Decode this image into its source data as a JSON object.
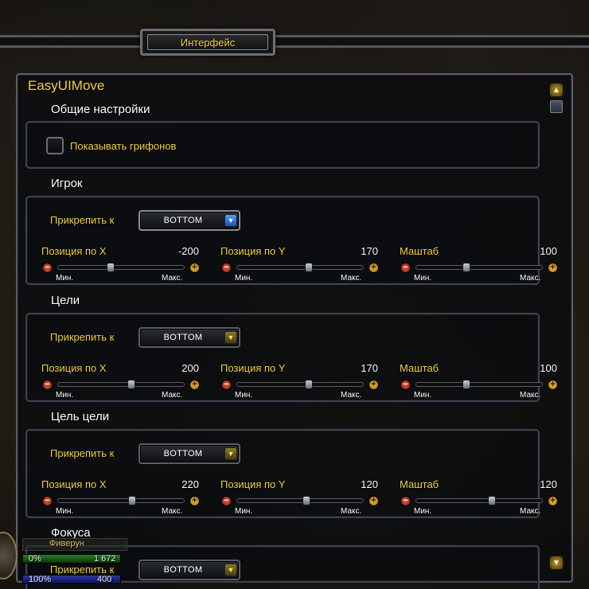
{
  "window_title": "Интерфейс",
  "addon_title": "EasyUIMove",
  "general": {
    "heading": "Общие настройки",
    "checkbox_label": "Показывать грифонов",
    "checkbox_checked": false
  },
  "sections": [
    {
      "heading": "Игрок",
      "anchor_label": "Прикрепить к",
      "anchor_value": "BOTTOM",
      "anchor_active": true,
      "sliders": [
        {
          "label": "Позиция по X",
          "value": "-200",
          "min_label": "Мин.",
          "max_label": "Макс.",
          "fraction": 0.42
        },
        {
          "label": "Позиция по Y",
          "value": "170",
          "min_label": "Мин.",
          "max_label": "Макс.",
          "fraction": 0.57
        },
        {
          "label": "Маштаб",
          "value": "100",
          "min_label": "Мин.",
          "max_label": "Макс.",
          "fraction": 0.4
        }
      ]
    },
    {
      "heading": "Цели",
      "anchor_label": "Прикрепить к",
      "anchor_value": "BOTTOM",
      "anchor_active": false,
      "sliders": [
        {
          "label": "Позиция по X",
          "value": "200",
          "min_label": "Мин.",
          "max_label": "Макс.",
          "fraction": 0.58
        },
        {
          "label": "Позиция по Y",
          "value": "170",
          "min_label": "Мин.",
          "max_label": "Макс.",
          "fraction": 0.57
        },
        {
          "label": "Маштаб",
          "value": "100",
          "min_label": "Мин.",
          "max_label": "Макс.",
          "fraction": 0.4
        }
      ]
    },
    {
      "heading": "Цель цели",
      "anchor_label": "Прикрепить к",
      "anchor_value": "BOTTOM",
      "anchor_active": false,
      "sliders": [
        {
          "label": "Позиция по X",
          "value": "220",
          "min_label": "Мин.",
          "max_label": "Макс.",
          "fraction": 0.59
        },
        {
          "label": "Позиция по Y",
          "value": "120",
          "min_label": "Мин.",
          "max_label": "Макс.",
          "fraction": 0.55
        },
        {
          "label": "Маштаб",
          "value": "120",
          "min_label": "Мин.",
          "max_label": "Макс.",
          "fraction": 0.6
        }
      ]
    },
    {
      "heading": "Фокуса",
      "anchor_label": "Прикрепить к",
      "anchor_value": "BOTTOM",
      "anchor_active": false,
      "sliders": []
    }
  ],
  "unit_frame": {
    "name": "Фиверун",
    "health_percent": "0%",
    "health_value": "1 672",
    "power_percent": "100%",
    "power_value": "400"
  },
  "icons": {
    "scroll_up": "scroll-up-icon",
    "scroll_down": "scroll-down-icon",
    "dropdown": "chevron-down-icon",
    "minus": "minus-icon",
    "plus": "plus-icon"
  },
  "colors": {
    "gold_text": "#f2d33a",
    "white_text": "#ffffff",
    "border": "#3d4450",
    "active_arrow": "#4aa0ff"
  }
}
